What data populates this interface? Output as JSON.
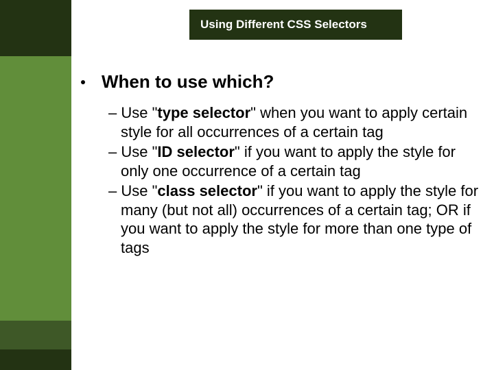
{
  "title": "Using Different CSS Selectors",
  "heading": "When to use which?",
  "items": [
    {
      "dash": "– ",
      "pre": "Use \"",
      "bold": "type selector",
      "post": "\" when you want to apply certain style for all occurrences of a certain tag"
    },
    {
      "dash": "– ",
      "pre": "Use \"",
      "bold": "ID selector",
      "post": "\" if you want to apply the style for only one occurrence of a certain tag"
    },
    {
      "dash": "– ",
      "pre": "Use \"",
      "bold": "class selector",
      "post": "\" if you want to apply the style for many (but not all) occurrences of a certain tag; OR if you want to apply the style for more than one type of tags"
    }
  ]
}
